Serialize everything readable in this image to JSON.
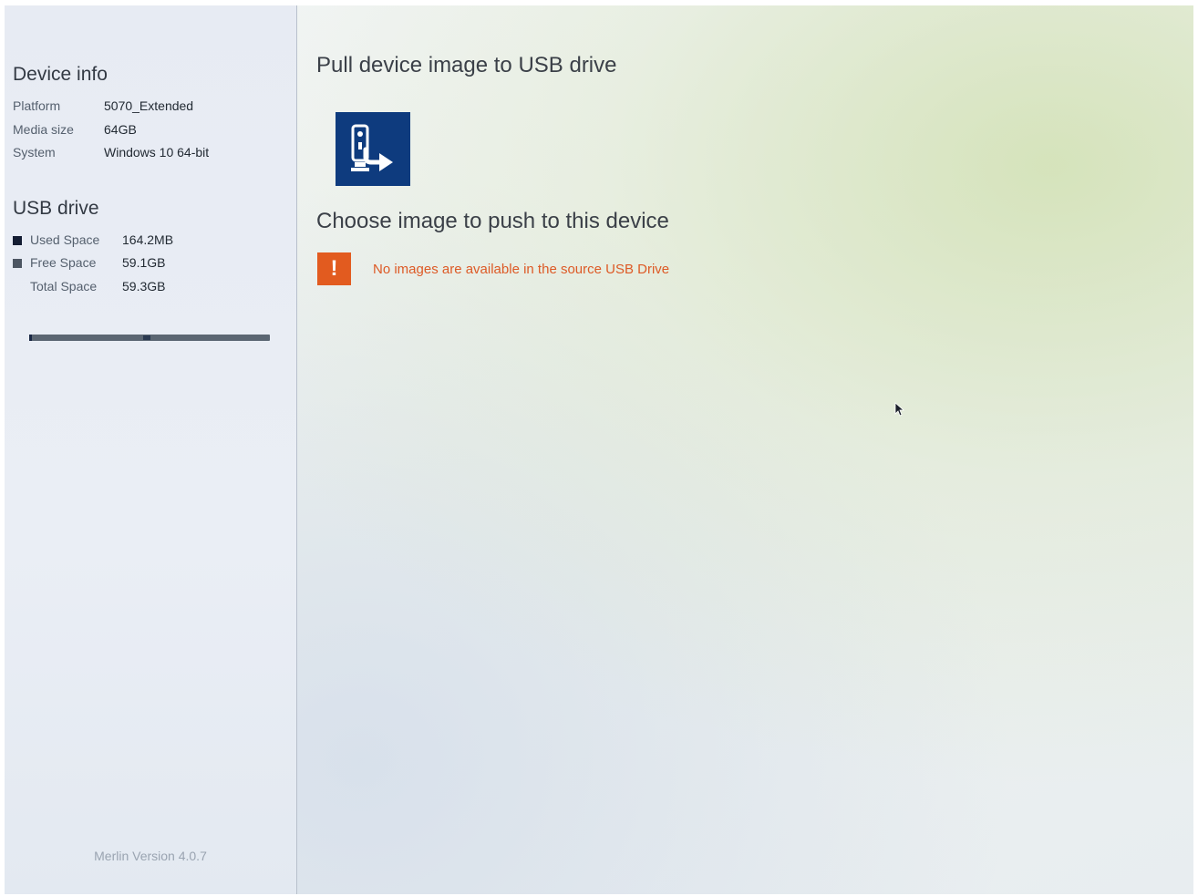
{
  "sidebar": {
    "device_info": {
      "title": "Device info",
      "rows": [
        {
          "label": "Platform",
          "value": "5070_Extended"
        },
        {
          "label": "Media size",
          "value": "64GB"
        },
        {
          "label": "System",
          "value": "Windows 10 64-bit"
        }
      ]
    },
    "usb_drive": {
      "title": "USB drive",
      "rows": [
        {
          "label": "Used Space",
          "value": "164.2MB",
          "swatch": "#141d33"
        },
        {
          "label": "Free Space",
          "value": "59.1GB",
          "swatch": "#4d5662"
        },
        {
          "label": "Total Space",
          "value": "59.3GB"
        }
      ],
      "used_fraction": 0.003
    },
    "version": "Merlin Version 4.0.7"
  },
  "main": {
    "pull_title": "Pull device image to USB drive",
    "pull_icon": "usb-export-icon",
    "push_title": "Choose image to push to this device",
    "warning_icon": "!",
    "warning_text": "No images are available in the source USB Drive"
  },
  "colors": {
    "tile": "#0e3b7e",
    "warning": "#e25b1f",
    "warning_text": "#dd5a26"
  }
}
